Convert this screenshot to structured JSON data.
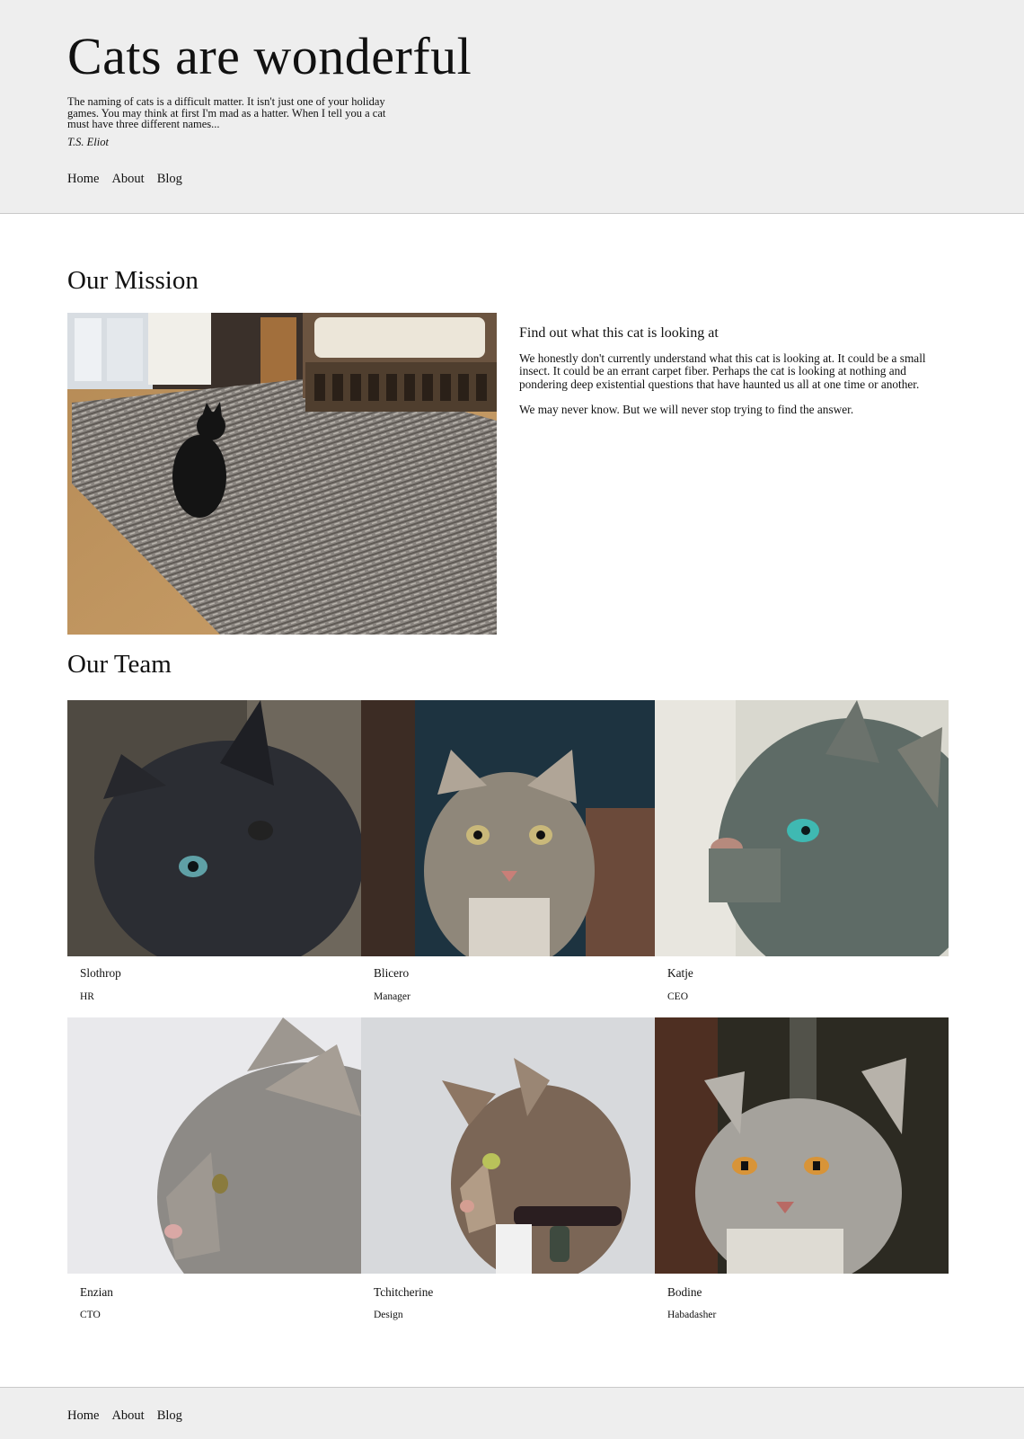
{
  "header": {
    "title": "Cats are wonderful",
    "quote": "The naming of cats is a difficult matter. It isn't just one of your holiday games. You may think at first I'm mad as a hatter. When I tell you a cat must have three different names...",
    "quote_author": "T.S. Eliot",
    "nav": [
      "Home",
      "About",
      "Blog"
    ]
  },
  "mission": {
    "heading": "Our Mission",
    "subheading": "Find out what this cat is looking at",
    "paragraphs": [
      "We honestly don't currently understand what this cat is looking at. It could be a small insect. It could be an errant carpet fiber. Perhaps the cat is looking at nothing and pondering deep existential questions that have haunted us all at one time or another.",
      "We may never know. But we will never stop trying to find the answer."
    ]
  },
  "team": {
    "heading": "Our Team",
    "members": [
      {
        "name": "Slothrop",
        "role": "HR"
      },
      {
        "name": "Blicero",
        "role": "Manager"
      },
      {
        "name": "Katje",
        "role": "CEO"
      },
      {
        "name": "Enzian",
        "role": "CTO"
      },
      {
        "name": "Tchitcherine",
        "role": "Design"
      },
      {
        "name": "Bodine",
        "role": "Habadasher"
      }
    ]
  },
  "footer": {
    "nav": [
      "Home",
      "About",
      "Blog"
    ]
  },
  "colors": {
    "header_background": "#eeeeee",
    "page_background": "#ffffff",
    "text": "#111111"
  }
}
